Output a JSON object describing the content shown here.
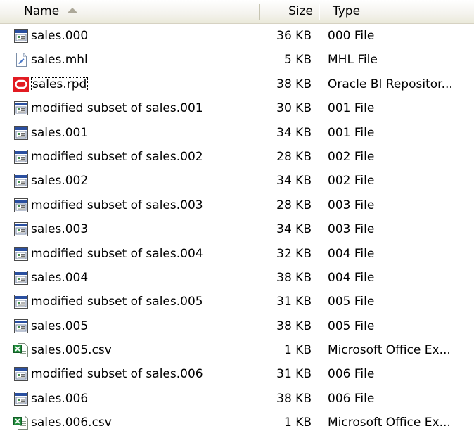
{
  "columns": {
    "name": "Name",
    "size": "Size",
    "type": "Type",
    "sort_column": "Name",
    "sort_direction": "ascending"
  },
  "files": [
    {
      "name": "sales.000",
      "size": "36 KB",
      "type": "000 File",
      "icon": "generic-file-icon"
    },
    {
      "name": "sales.mhl",
      "size": "5 KB",
      "type": "MHL File",
      "icon": "text-file-icon"
    },
    {
      "name": "sales.rpd",
      "size": "38 KB",
      "type": "Oracle BI Repositor...",
      "icon": "oracle-repository-icon",
      "focused": true
    },
    {
      "name": "modified subset of sales.001",
      "size": "30 KB",
      "type": "001 File",
      "icon": "generic-file-icon"
    },
    {
      "name": "sales.001",
      "size": "34 KB",
      "type": "001 File",
      "icon": "generic-file-icon"
    },
    {
      "name": "modified subset of sales.002",
      "size": "28 KB",
      "type": "002 File",
      "icon": "generic-file-icon"
    },
    {
      "name": "sales.002",
      "size": "34 KB",
      "type": "002 File",
      "icon": "generic-file-icon"
    },
    {
      "name": "modified subset of sales.003",
      "size": "28 KB",
      "type": "003 File",
      "icon": "generic-file-icon"
    },
    {
      "name": "sales.003",
      "size": "34 KB",
      "type": "003 File",
      "icon": "generic-file-icon"
    },
    {
      "name": "modified subset of sales.004",
      "size": "32 KB",
      "type": "004 File",
      "icon": "generic-file-icon"
    },
    {
      "name": "sales.004",
      "size": "38 KB",
      "type": "004 File",
      "icon": "generic-file-icon"
    },
    {
      "name": "modified subset of sales.005",
      "size": "31 KB",
      "type": "005 File",
      "icon": "generic-file-icon"
    },
    {
      "name": "sales.005",
      "size": "38 KB",
      "type": "005 File",
      "icon": "generic-file-icon"
    },
    {
      "name": "sales.005.csv",
      "size": "1 KB",
      "type": "Microsoft Office Ex...",
      "icon": "excel-csv-icon"
    },
    {
      "name": "modified subset of sales.006",
      "size": "31 KB",
      "type": "006 File",
      "icon": "generic-file-icon"
    },
    {
      "name": "sales.006",
      "size": "38 KB",
      "type": "006 File",
      "icon": "generic-file-icon"
    },
    {
      "name": "sales.006.csv",
      "size": "1 KB",
      "type": "Microsoft Office Ex...",
      "icon": "excel-csv-icon"
    }
  ],
  "colors": {
    "header_bg": "#ebeadb",
    "oracle_red": "#e21b22",
    "excel_green": "#1f8a3a",
    "icon_blue": "#2a4fa0"
  }
}
